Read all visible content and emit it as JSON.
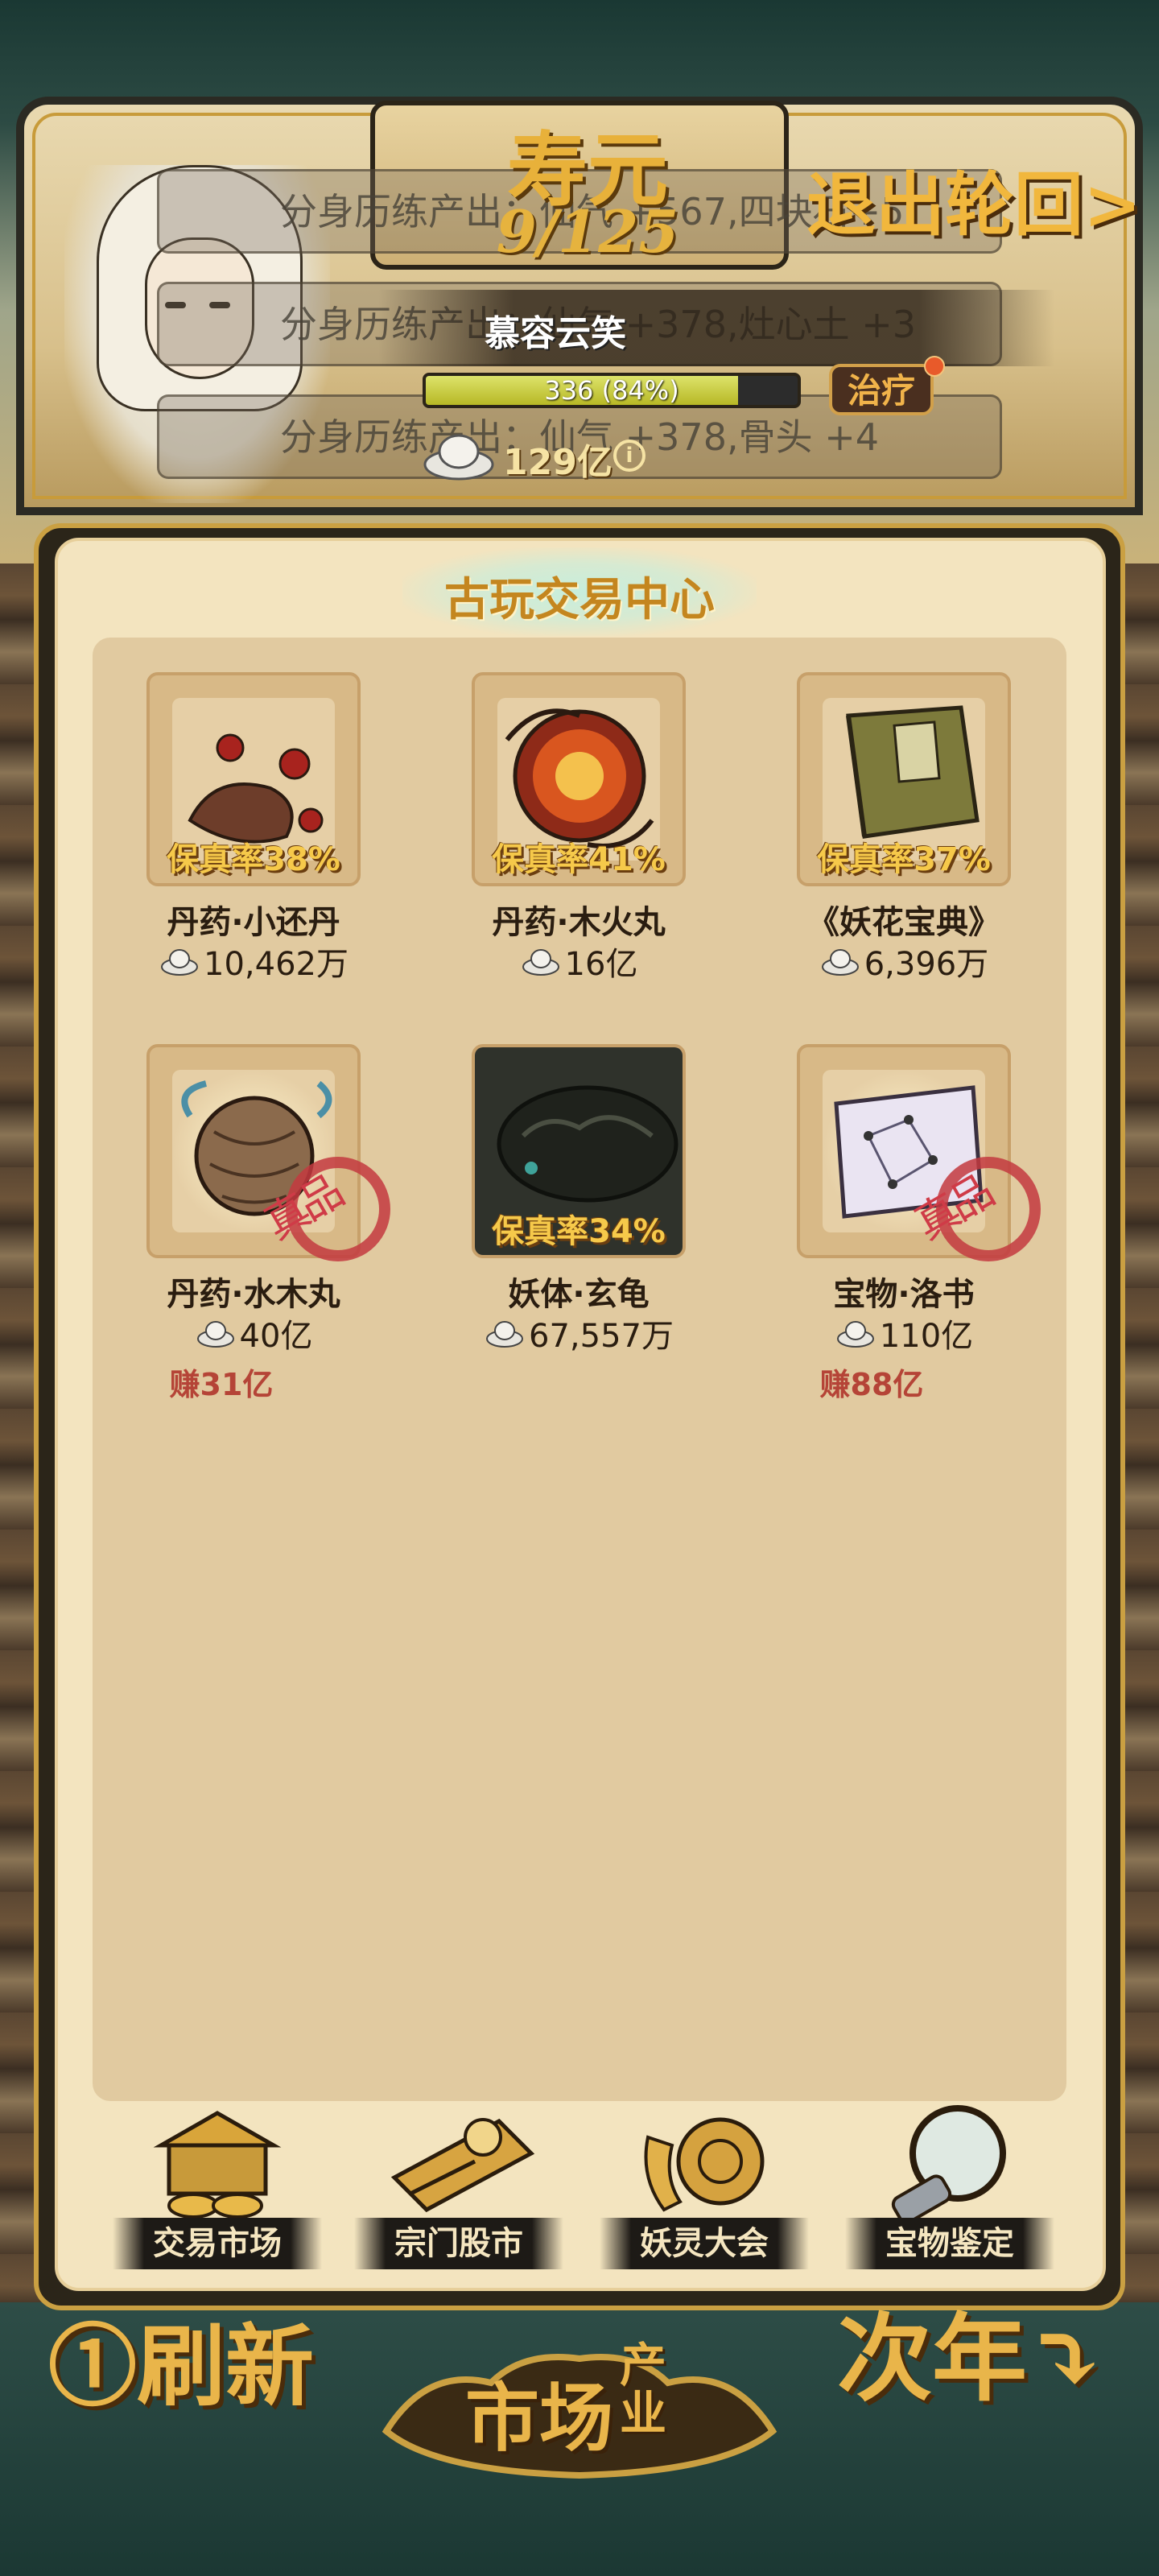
{
  "header": {
    "lifespan_title": "寿元",
    "lifespan_value": "9/125",
    "exit_label": "退出轮回>",
    "character_name": "慕容云笑",
    "hp_text": "336 (84%)",
    "hp_percent": 84,
    "heal_label": "治疗",
    "silver_amount": "129亿",
    "info_symbol": "i",
    "log_lines": [
      "分身历练产出：仙气 +567,四块石+5",
      "分身历练产出：仙气 +378,灶心土 +3",
      "分身历练产出：仙气 +378,骨头 +4"
    ]
  },
  "panel": {
    "title": "古玩交易中心",
    "items": [
      {
        "name": "丹药·小还丹",
        "price": "10,462万",
        "rate": "保真率38%",
        "profit": "",
        "stamped": false,
        "icon": "pills-pouch-icon"
      },
      {
        "name": "丹药·木火丸",
        "price": "16亿",
        "rate": "保真率41%",
        "profit": "",
        "stamped": false,
        "icon": "fire-pill-icon"
      },
      {
        "name": "《妖花宝典》",
        "price": "6,396万",
        "rate": "保真率37%",
        "profit": "",
        "stamped": false,
        "icon": "book-icon"
      },
      {
        "name": "丹药·水木丸",
        "price": "40亿",
        "rate": "",
        "profit": "赚31亿",
        "stamped": true,
        "stamp_text": "真品",
        "icon": "water-pill-icon"
      },
      {
        "name": "妖体·玄龟",
        "price": "67,557万",
        "rate": "保真率34%",
        "profit": "",
        "stamped": false,
        "icon": "turtle-icon"
      },
      {
        "name": "宝物·洛书",
        "price": "110亿",
        "rate": "",
        "profit": "赚88亿",
        "stamped": true,
        "stamp_text": "真品",
        "icon": "scroll-map-icon"
      }
    ]
  },
  "nav": [
    {
      "label": "交易市场",
      "icon": "market-stall-icon"
    },
    {
      "label": "宗门股市",
      "icon": "stock-scroll-icon"
    },
    {
      "label": "妖灵大会",
      "icon": "gong-icon"
    },
    {
      "label": "宝物鉴定",
      "icon": "magnifier-icon"
    }
  ],
  "bottom": {
    "refresh_label": "①刷新",
    "market_title": "市场",
    "market_subtitle": "产业",
    "next_year_label": "次年⤵"
  },
  "colors": {
    "accent_gold": "#e9b54a",
    "panel_bg": "#f3e4bf",
    "profit_red": "#b54437",
    "rate_gold": "#f6c94a"
  }
}
